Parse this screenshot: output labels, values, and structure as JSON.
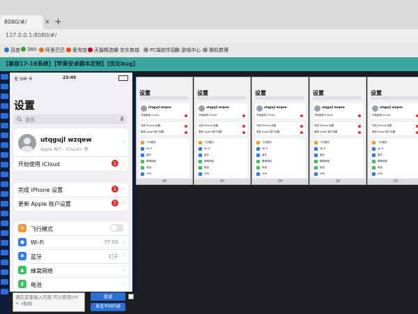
{
  "browser": {
    "tab_title": "8080/#/",
    "tab_close": "×",
    "new_tab": "+",
    "url": "127.0.0.1:8080/#/"
  },
  "bookmarks": [
    {
      "label": "百度",
      "color": "#2b6fd6"
    },
    {
      "label": "360",
      "color": "#3aa13a"
    },
    {
      "label": "阿里巴巴",
      "color": "#ff6a00"
    },
    {
      "label": "爱淘宝",
      "color": "#ff4400"
    },
    {
      "label": "天猫精选",
      "color": "#d0021b"
    },
    {
      "label": "京东商城",
      "color": "#8c8c8c"
    },
    {
      "label": "PC端软件园",
      "color": "#8c8c8c"
    },
    {
      "label": "游戏中心",
      "color": "#8c8c8c"
    },
    {
      "label": "微机数理",
      "color": "#8c8c8c"
    }
  ],
  "app": {
    "title": "【兼容17-18系统】【苹果安卓脚本定制】【优化bug】"
  },
  "phone": {
    "status_left": "无 SIM 卡",
    "status_time": "23:49",
    "title": "设置",
    "search_placeholder": "搜索",
    "user_name": "utqgujl wzqew",
    "user_sub": "Apple 账户、iCloud+ 等",
    "icloud_label": "开始使用 iCloud",
    "icloud_badge": "1",
    "setup_label": "完成 iPhone 设置",
    "setup_badge": "1",
    "update_label": "更新 Apple 账户设置",
    "update_badge": "1",
    "settings_rows": [
      {
        "label": "飞行模式",
        "value": "",
        "icon_color": "#f19a37",
        "toggle": true
      },
      {
        "label": "Wi-Fi",
        "value": "ST-5G",
        "icon_color": "#2b7bf0",
        "toggle": false
      },
      {
        "label": "蓝牙",
        "value": "打开",
        "icon_color": "#2b7bf0",
        "toggle": false
      },
      {
        "label": "蜂窝网络",
        "value": "",
        "icon_color": "#37c25a",
        "toggle": false
      },
      {
        "label": "电池",
        "value": "",
        "icon_color": "#37c25a",
        "toggle": false
      }
    ]
  },
  "mini_phones": [
    {
      "title": "设置",
      "name": "utqgujl wzqew",
      "footer": "08"
    },
    {
      "title": "设置",
      "name": "utqgujl wzqew",
      "footer": "05"
    },
    {
      "title": "设置",
      "name": "utqgujl wzqew",
      "footer": "04"
    },
    {
      "title": "设置",
      "name": "utqgujl wzqew",
      "footer": "10"
    },
    {
      "title": "设置",
      "name": "utqgujl wzqew",
      "footer": "03"
    }
  ],
  "mini_lines": {
    "icloud": "开始使用 iCloud",
    "setup": "完成 iPhone 设置",
    "update": "更新 Apple 账户设置",
    "airplane": "飞行模式",
    "wifi": "Wi-Fi",
    "bt": "蓝牙",
    "cell": "蜂窝网络",
    "battery": "电池",
    "vpn": "VPN"
  },
  "bottom": {
    "input_placeholder": "请在这里输入内容,可以使用ctrl + v粘贴",
    "send_label": "发送",
    "send_inner_label": "发送不同内容"
  },
  "colors": {
    "accent": "#2b6fd6",
    "header": "#3aa6a0",
    "badge": "#e0302d",
    "background": "#1c1e22"
  }
}
